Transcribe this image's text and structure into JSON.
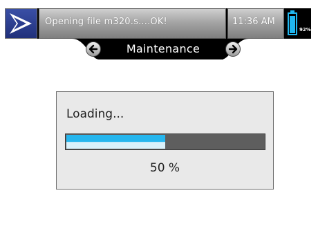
{
  "status_bar": {
    "message": "Opening file m320.s....OK!",
    "time": "11:36 AM",
    "battery_percent_label": "92%",
    "battery_level": 0.92
  },
  "navigation": {
    "title": "Maintenance",
    "back_icon": "arrow-left-icon",
    "forward_icon": "arrow-right-icon"
  },
  "loading_dialog": {
    "title": "Loading...",
    "progress": 0.5,
    "progress_label": "50 %"
  },
  "colors": {
    "accent": "#26b6ee",
    "logo": "#2b3d8f",
    "bar": "#000000"
  }
}
